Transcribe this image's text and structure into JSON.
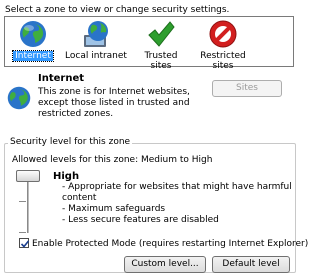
{
  "prompt": "Select a zone to view or change security settings.",
  "zones": [
    {
      "label": "Internet",
      "icon": "globe-icon",
      "selected": true
    },
    {
      "label": "Local intranet",
      "icon": "intranet-globe-icon",
      "selected": false
    },
    {
      "label": "Trusted sites",
      "icon": "green-check-icon",
      "selected": false
    },
    {
      "label": "Restricted sites",
      "icon": "red-no-entry-icon",
      "selected": false
    }
  ],
  "zone_info": {
    "title": "Internet",
    "description": "This zone is for Internet websites, except those listed in trusted and restricted zones.",
    "sites_button": "Sites"
  },
  "security": {
    "group_label": "Security level for this zone",
    "allowed_levels": "Allowed levels for this zone: Medium to High",
    "level_title": "High",
    "level_points": [
      "- Appropriate for websites that might have harmful content",
      "- Maximum safeguards",
      "- Less secure features are disabled"
    ],
    "slider_level": "High",
    "protected_mode": {
      "checked": true,
      "label": "Enable Protected Mode (requires restarting Internet Explorer)"
    },
    "custom_button": "Custom level...",
    "default_button": "Default level"
  },
  "colors": {
    "selection": "#3399ff",
    "check_green": "#2e9e2e",
    "restricted_red": "#d21f1f",
    "globe_blue": "#2a74c9"
  }
}
